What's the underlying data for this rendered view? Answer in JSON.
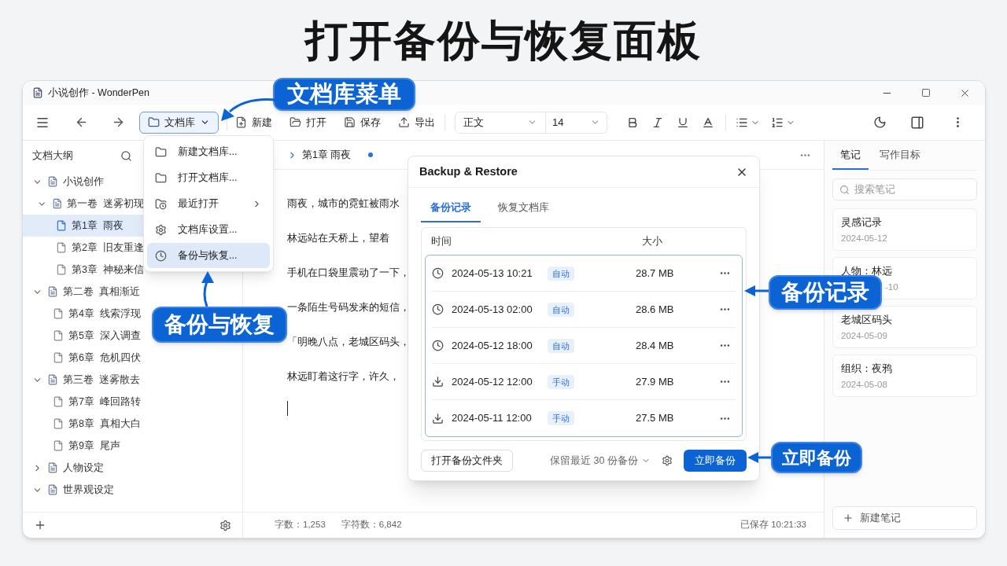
{
  "page_title": "打开备份与恢复面板",
  "window": {
    "title": "小说创作 - WonderPen"
  },
  "toolbar": {
    "library_button": {
      "label": "文档库",
      "selected": true
    },
    "actions": [
      {
        "label": "新建",
        "kind": "new"
      },
      {
        "label": "打开",
        "kind": "open"
      },
      {
        "label": "保存",
        "kind": "save"
      },
      {
        "label": "导出",
        "kind": "export"
      }
    ],
    "style_select": {
      "value": "正文"
    },
    "size_select": {
      "value": "14"
    }
  },
  "library_menu": {
    "items": [
      {
        "label": "新建文档库...",
        "kind": "new",
        "selected": false
      },
      {
        "label": "打开文档库...",
        "kind": "open",
        "selected": false
      },
      {
        "label": "最近打开",
        "kind": "recent",
        "selected": false,
        "submenu": true
      },
      {
        "label": "文档库设置...",
        "kind": "settings",
        "selected": false
      },
      {
        "label": "备份与恢复...",
        "kind": "backup",
        "selected": true
      }
    ]
  },
  "sidebar": {
    "title": "文档大纲",
    "tree": [
      {
        "label": "小说创作",
        "kind": "folder",
        "expanded": true,
        "selected": false,
        "children": [
          {
            "label": "第一卷  迷雾初现",
            "kind": "folder",
            "expanded": true,
            "selected": false,
            "children": [
              {
                "label": "第1章  雨夜",
                "kind": "chapter",
                "selected": true
              },
              {
                "label": "第2章  旧友重逢",
                "kind": "chapter",
                "selected": false
              },
              {
                "label": "第3章  神秘来信",
                "kind": "chapter",
                "selected": false
              }
            ]
          }
        ]
      },
      {
        "label": "第二卷  真相渐近",
        "kind": "folder",
        "expanded": true,
        "selected": false,
        "children": [
          {
            "label": "第4章  线索浮现",
            "kind": "chapter",
            "selected": false
          },
          {
            "label": "第5章  深入调查",
            "kind": "chapter",
            "selected": false
          },
          {
            "label": "第6章  危机四伏",
            "kind": "chapter",
            "selected": false
          }
        ]
      },
      {
        "label": "第三卷  迷雾散去",
        "kind": "folder",
        "expanded": true,
        "selected": false,
        "children": [
          {
            "label": "第7章  峰回路转",
            "kind": "chapter",
            "selected": false
          },
          {
            "label": "第8章  真相大白",
            "kind": "chapter",
            "selected": false
          },
          {
            "label": "第9章  尾声",
            "kind": "chapter",
            "selected": false
          }
        ]
      },
      {
        "label": "人物设定",
        "kind": "folder",
        "expanded": false,
        "selected": false
      },
      {
        "label": "世界观设定",
        "kind": "folder",
        "expanded": true,
        "selected": false
      }
    ]
  },
  "editor": {
    "breadcrumb": "第1章 雨夜",
    "modified": true,
    "paragraphs": [
      "雨夜，城市的霓虹被雨水",
      "林远站在天桥上，望着",
      "手机在口袋里震动了一下，",
      "一条陌生号码发来的短信，",
      "「明晚八点，老城区码头，",
      "林远盯着这行字，许久，"
    ]
  },
  "dialog": {
    "title": "Backup & Restore",
    "tabs": [
      {
        "label": "备份记录",
        "selected": true
      },
      {
        "label": "恢复文档库",
        "selected": false
      }
    ],
    "columns": [
      "时间",
      "大小"
    ],
    "rows": [
      {
        "time": "2024-05-13 10:21",
        "kind": "auto",
        "tag": "自动",
        "size": "28.7 MB"
      },
      {
        "time": "2024-05-13 02:00",
        "kind": "auto",
        "tag": "自动",
        "size": "28.6 MB"
      },
      {
        "time": "2024-05-12 18:00",
        "kind": "auto",
        "tag": "自动",
        "size": "28.4 MB"
      },
      {
        "time": "2024-05-12 12:00",
        "kind": "manual",
        "tag": "手动",
        "size": "27.9 MB"
      },
      {
        "time": "2024-05-11 12:00",
        "kind": "manual",
        "tag": "手动",
        "size": "27.5 MB"
      }
    ],
    "open_folder_button": "打开备份文件夹",
    "retention_select": "保留最近 30 份备份",
    "backup_now_button": "立即备份"
  },
  "notes_panel": {
    "tabs": [
      {
        "label": "笔记",
        "selected": true
      },
      {
        "label": "写作目标",
        "selected": false
      }
    ],
    "search": {
      "placeholder": "搜索笔记"
    },
    "notes": [
      {
        "title": "灵感记录",
        "date": "2024-05-12"
      },
      {
        "title": "人物：林远",
        "date": "-10"
      },
      {
        "title": "老城区码头",
        "date": "2024-05-09"
      },
      {
        "title": "组织：夜鸦",
        "date": "2024-05-08"
      }
    ],
    "new_note_button": "新建笔记"
  },
  "status_bar": {
    "word_count": "字数：1,253",
    "char_count": "字符数：6,842",
    "saved": "已保存 10:21:33"
  },
  "annotations": [
    {
      "text": "文档库菜单"
    },
    {
      "text": "备份与恢复"
    },
    {
      "text": "备份记录"
    },
    {
      "text": "立即备份"
    }
  ]
}
